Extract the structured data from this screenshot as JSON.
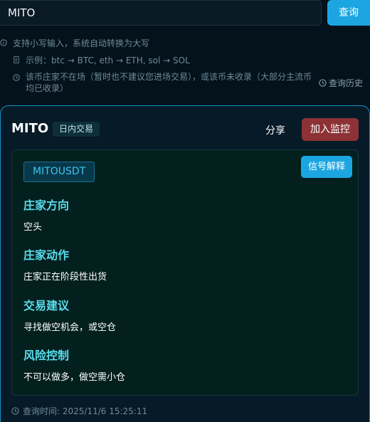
{
  "search": {
    "value": "MITO",
    "button_label": "查询"
  },
  "hints": {
    "line1": "支持小写输入，系统自动转换为大写",
    "line2": "示例：btc → BTC, eth → ETH, sol → SOL",
    "line3": "该币庄家不在场（暂时也不建议您进场交易），或该币未收录（大部分主流币均已收录）",
    "history_label": "查询历史"
  },
  "result": {
    "title": "MITO",
    "badge": "日内交易",
    "share_label": "分享",
    "watch_label": "加入监控",
    "symbol": "MITOUSDT",
    "explain_label": "信号解释",
    "sections": [
      {
        "heading": "庄家方向",
        "text": "空头"
      },
      {
        "heading": "庄家动作",
        "text": "庄家正在阶段性出货"
      },
      {
        "heading": "交易建议",
        "text": "寻找做空机会，或空仓"
      },
      {
        "heading": "风险控制",
        "text": "不可以做多，做空需小仓"
      }
    ],
    "query_time": "查询时间: 2025/11/6 15:25:11"
  },
  "colors": {
    "accent": "#1ba6e1",
    "danger": "#8c3236",
    "heading": "#59dcea"
  }
}
